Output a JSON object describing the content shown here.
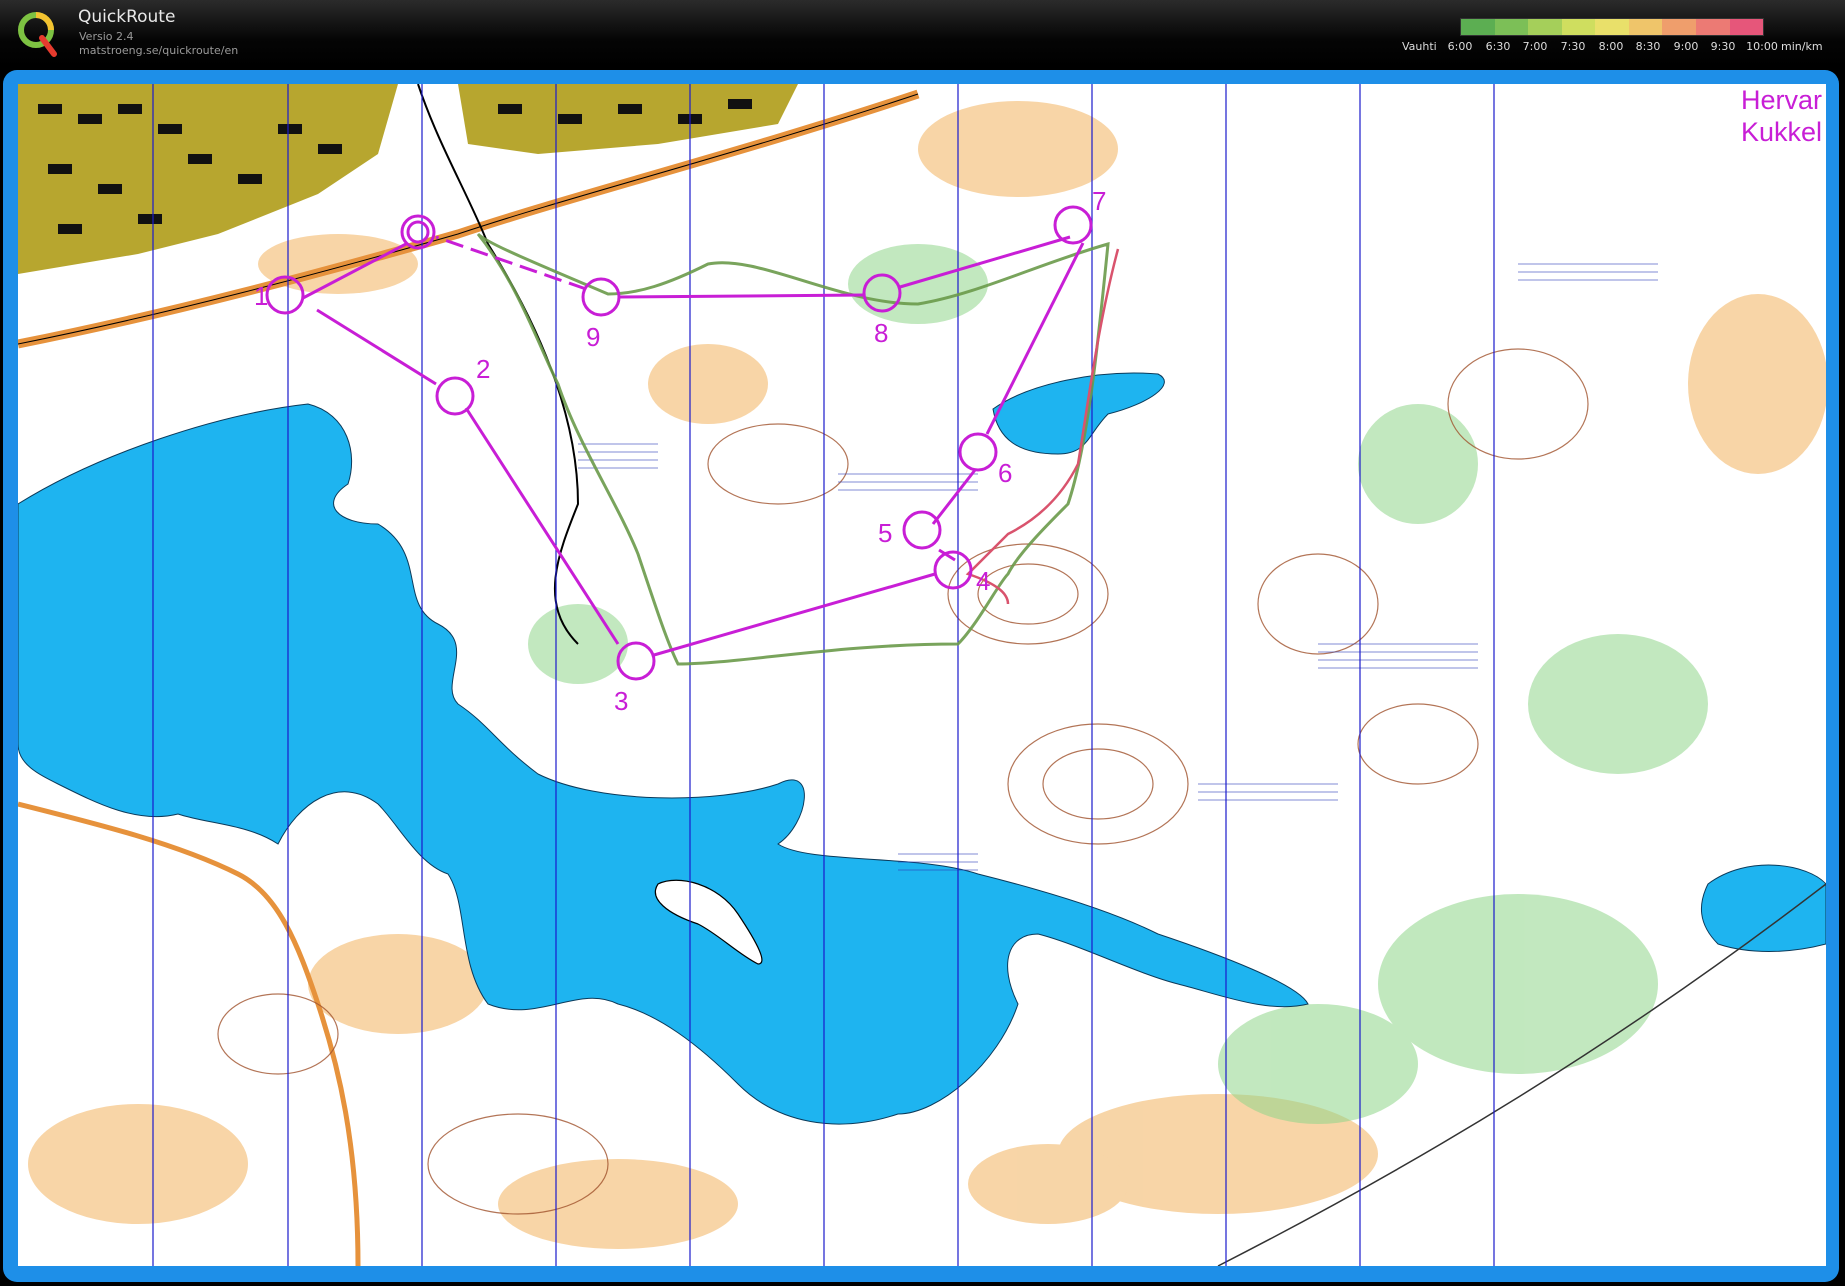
{
  "app": {
    "title": "QuickRoute",
    "version": "Versio 2.4",
    "url": "matstroeng.se/quickroute/en"
  },
  "pace_legend": {
    "label": "Vauhti",
    "ticks": [
      "6:00",
      "6:30",
      "7:00",
      "7:30",
      "8:00",
      "8:30",
      "9:00",
      "9:30",
      "10:00"
    ],
    "unit": "min/km",
    "colors": [
      "#5cae52",
      "#7cbf57",
      "#a5cf5a",
      "#cfde5f",
      "#e9e06a",
      "#efc56a",
      "#ef9e6c",
      "#ec7a74",
      "#e6567a"
    ]
  },
  "map": {
    "credit_lines": [
      "Hervar",
      "Kukkel"
    ],
    "course_color": "#c81ed6",
    "water_color": "#1eb4f0",
    "controls": [
      {
        "label": "1"
      },
      {
        "label": "2"
      },
      {
        "label": "3"
      },
      {
        "label": "4"
      },
      {
        "label": "5"
      },
      {
        "label": "6"
      },
      {
        "label": "7"
      },
      {
        "label": "8"
      },
      {
        "label": "9"
      }
    ]
  }
}
